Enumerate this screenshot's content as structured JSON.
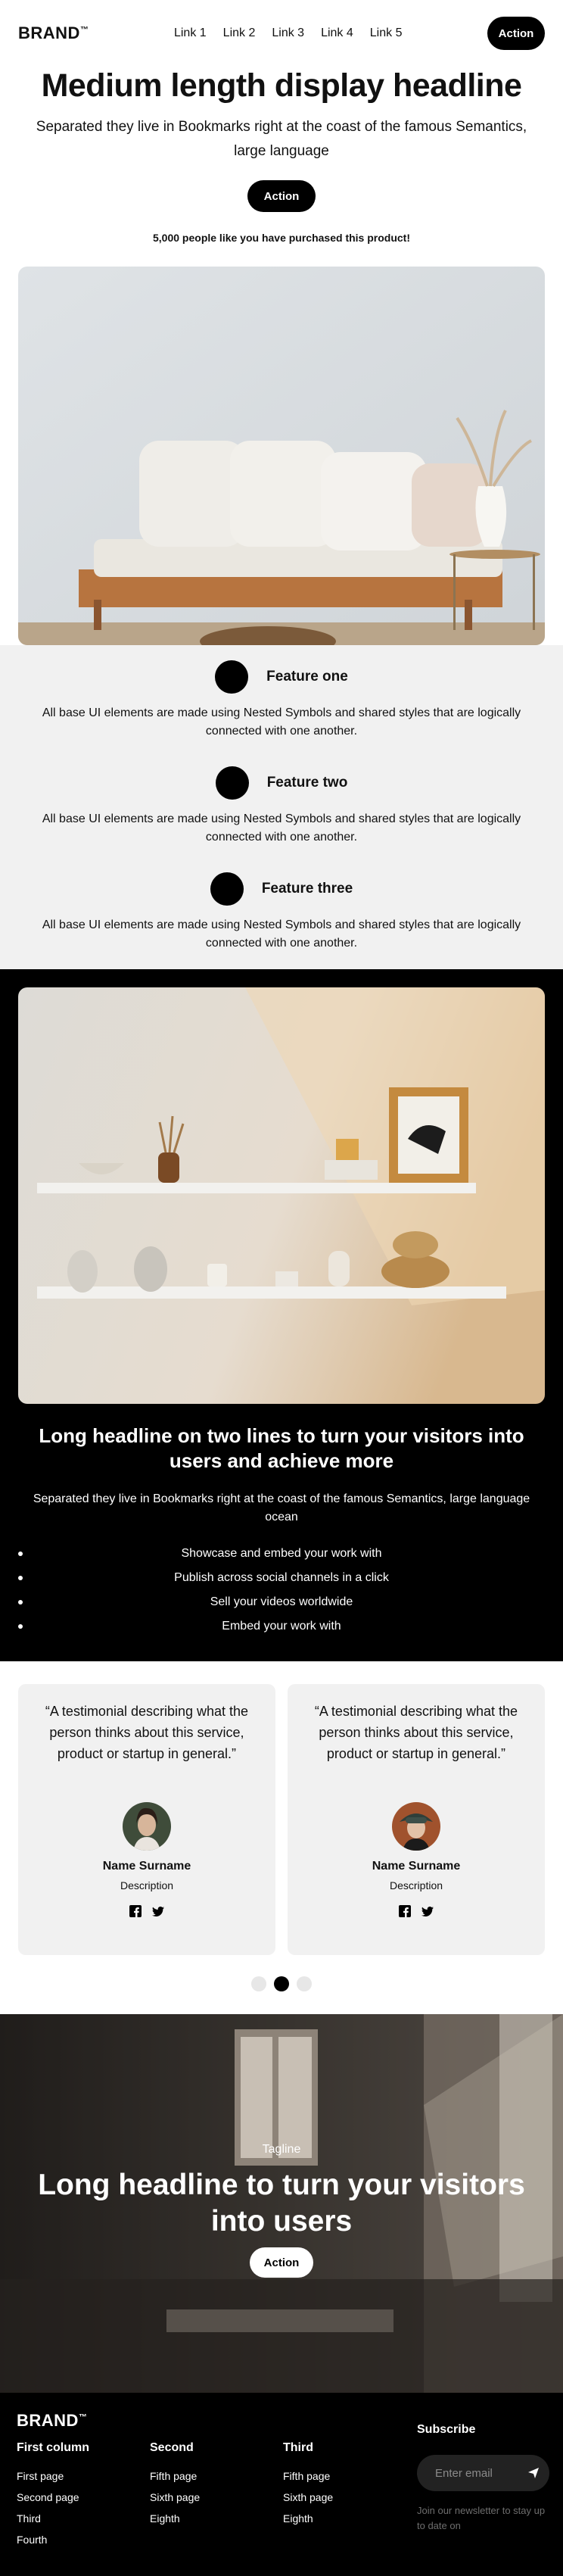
{
  "nav": {
    "brand": "BRAND",
    "brand_mark": "™",
    "links": [
      "Link 1",
      "Link 2",
      "Link 3",
      "Link 4",
      "Link 5"
    ],
    "action": "Action"
  },
  "hero": {
    "headline": "Medium length display headline",
    "subheadline": "Separated they live in Bookmarks right at the coast of the famous Semantics, large language",
    "action": "Action",
    "social_proof": "5,000 people like you have purchased this product!"
  },
  "features": [
    {
      "title": "Feature one",
      "text": "All base UI elements are made using Nested Symbols and shared styles that are logically connected with one another."
    },
    {
      "title": "Feature two",
      "text": "All base UI elements are made using Nested Symbols and shared styles that are logically connected with one another."
    },
    {
      "title": "Feature three",
      "text": "All base UI elements are made using Nested Symbols and shared styles that are logically connected with one another."
    }
  ],
  "dark_section": {
    "headline": "Long headline on two lines to turn your visitors into users and achieve more",
    "subheadline": "Separated they live in Bookmarks right at the coast of the famous Semantics, large language ocean",
    "bullets": [
      "Showcase and embed your work with",
      "Publish across social channels in a click",
      "Sell your videos worldwide",
      "Embed your work with"
    ]
  },
  "testimonials": [
    {
      "quote": "“A testimonial describing what the person thinks about this service, product or startup in general.”",
      "name": "Name Surname",
      "description": "Description"
    },
    {
      "quote": "“A testimonial describing what the person thinks about this service, product or startup in general.”",
      "name": "Name Surname",
      "description": "Description"
    }
  ],
  "carousel": {
    "pages": 3,
    "active": 2
  },
  "banner": {
    "tagline": "Tagline",
    "headline": "Long headline to turn your visitors into users",
    "action": "Action"
  },
  "footer": {
    "brand": "BRAND",
    "brand_mark": "™",
    "columns": [
      {
        "title": "First column",
        "links": [
          "First page",
          "Second page",
          "Third",
          "Fourth"
        ]
      },
      {
        "title": "Second",
        "links": [
          "Fifth page",
          "Sixth page",
          "Eighth"
        ]
      },
      {
        "title": "Third",
        "links": [
          "Fifth page",
          "Sixth page",
          "Eighth"
        ]
      }
    ],
    "subscribe": {
      "title": "Subscribe",
      "placeholder": "Enter email",
      "note": "Join our newsletter to stay up to date on"
    }
  },
  "colors": {
    "accent": "#000000",
    "light_bg": "#f1f1f1",
    "text": "#111111"
  }
}
